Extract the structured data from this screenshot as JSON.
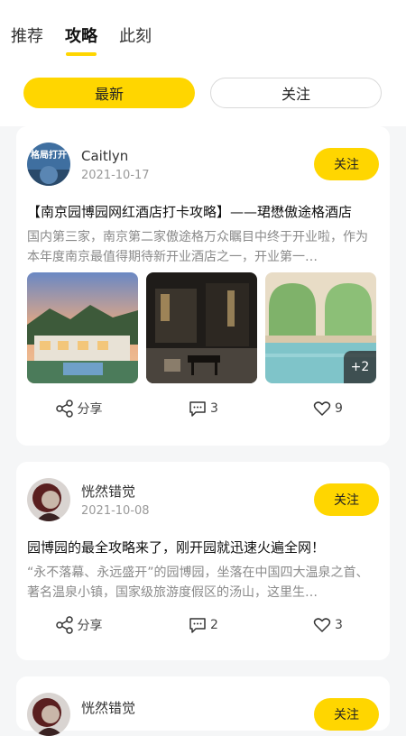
{
  "tabs": [
    {
      "label": "推荐",
      "active": false
    },
    {
      "label": "攻略",
      "active": true
    },
    {
      "label": "此刻",
      "active": false
    }
  ],
  "filters": {
    "latest": "最新",
    "following": "关注"
  },
  "colors": {
    "accent": "#ffd600",
    "background": "#f5f6f7"
  },
  "posts": [
    {
      "author": "Caitlyn",
      "date": "2021-10-17",
      "follow": "关注",
      "title": "【南京园博园网红酒店打卡攻略】——珺懋傲途格酒店",
      "excerpt": "国内第三家，南京第二家傲途格万众瞩目中终于开业啦，作为本年度南京最值得期待新开业酒店之一，开业第一…",
      "avatar_text": "格局打开",
      "more_images": "+2",
      "share": "分享",
      "comments": "3",
      "likes": "9"
    },
    {
      "author": "恍然错觉",
      "date": "2021-10-08",
      "follow": "关注",
      "title": "园博园的最全攻略来了，刚开园就迅速火遍全网！",
      "excerpt": "“永不落幕、永远盛开”的园博园，坐落在中国四大温泉之首、著名温泉小镇，国家级旅游度假区的汤山，这里生…",
      "share": "分享",
      "comments": "2",
      "likes": "3"
    },
    {
      "author": "恍然错觉",
      "follow": "关注"
    }
  ],
  "icons": [
    "share-icon",
    "comment-icon",
    "heart-icon"
  ]
}
